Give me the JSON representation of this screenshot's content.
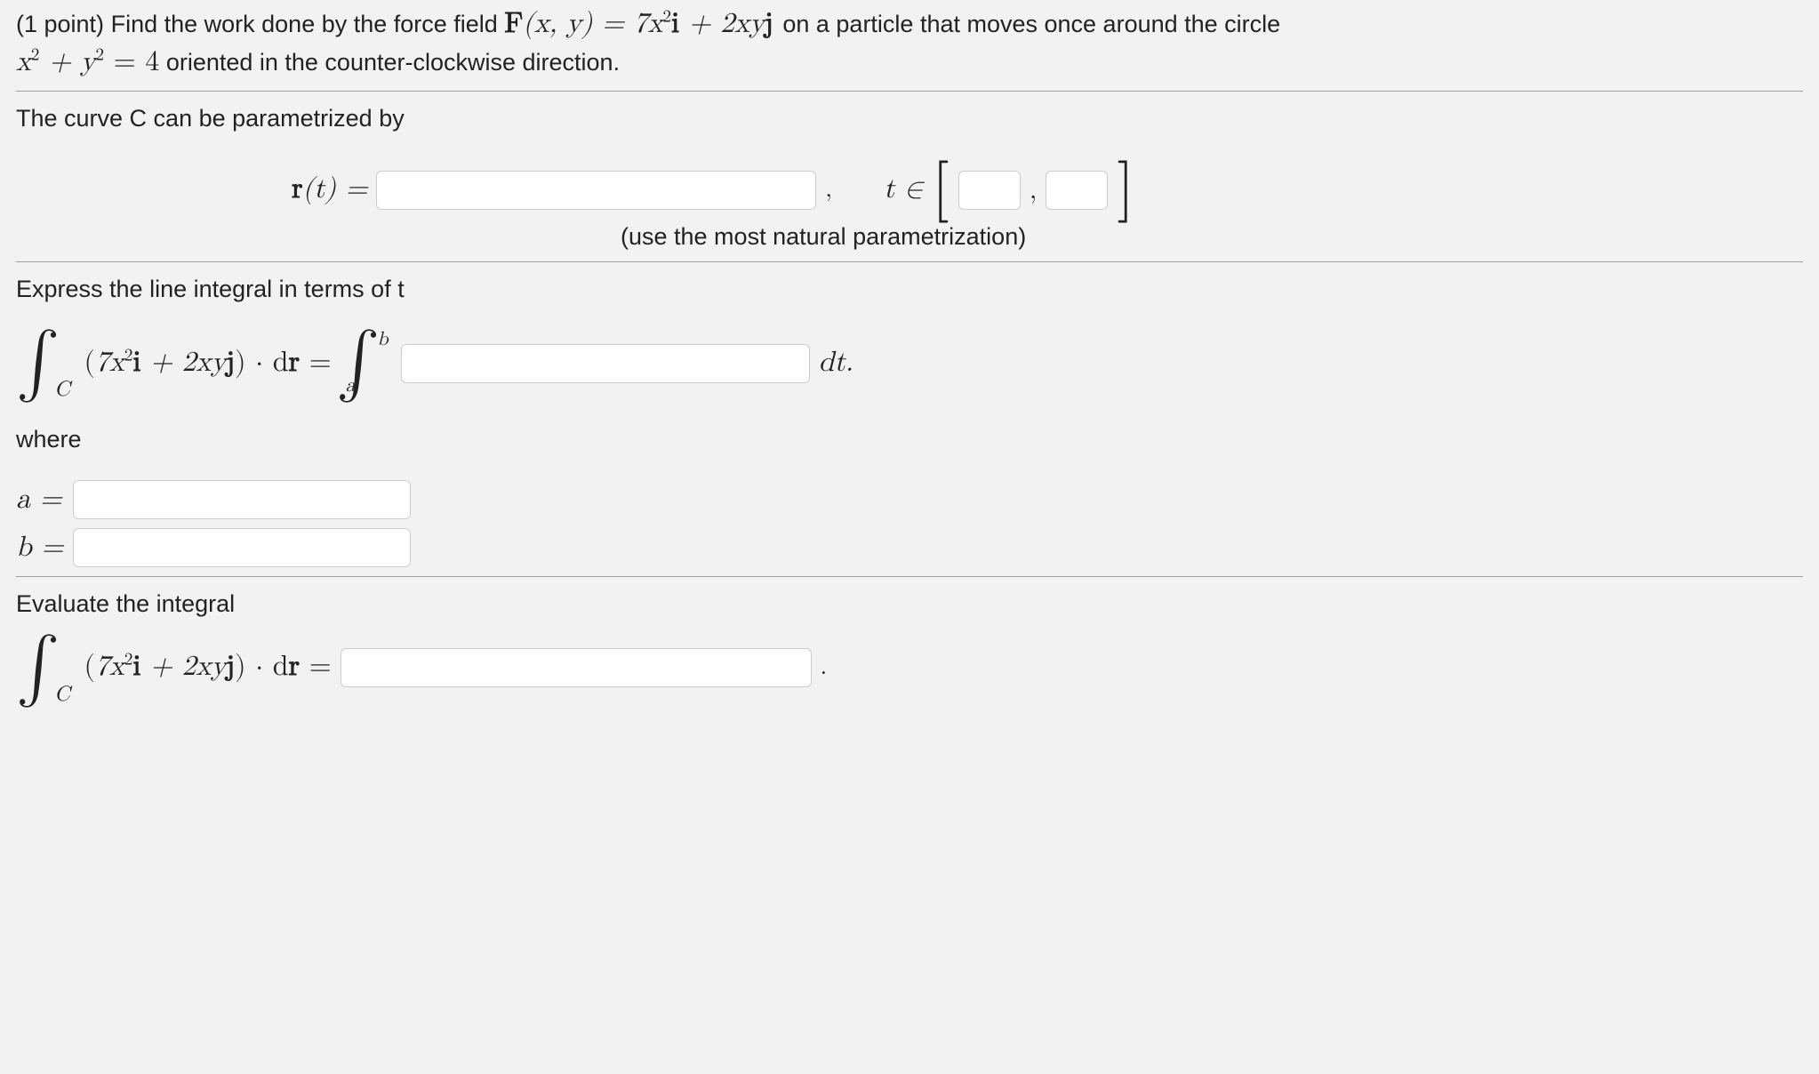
{
  "intro": {
    "points": "(1 point)",
    "lead": "Find the work done by the force field",
    "fieldF": "F",
    "fieldArgs": "(x, y) = 7x",
    "fieldRest": "i + 2xyj",
    "tail": "on a particle that moves once around the circle",
    "circle_lhs": "x",
    "circle_plus": " + y",
    "circle_eq": " = 4",
    "orient": "oriented in the counter-clockwise direction."
  },
  "section1": {
    "heading": "The curve C can be parametrized by",
    "r_label": "r",
    "r_arg": "(t) =",
    "t_label": "t ∈",
    "hint": "(use the most natural parametrization)"
  },
  "section2": {
    "heading": "Express the line integral in terms of t",
    "int_expr_7x": "7x",
    "int_expr_mid": "i + 2xy j",
    "int_expr_dot": " · d",
    "int_expr_r": "r",
    "eq": " =",
    "dt": "dt.",
    "where": "where",
    "a_label": "a =",
    "b_label": "b ="
  },
  "section3": {
    "heading": "Evaluate the integral",
    "eq": " =",
    "dot": "."
  },
  "integral_glyph": "∫",
  "C_sub": "C",
  "a_sub": "a",
  "b_sup": "b",
  "paren_open": "(",
  "paren_close": ")",
  "punct_comma": ",",
  "sup2": "2"
}
